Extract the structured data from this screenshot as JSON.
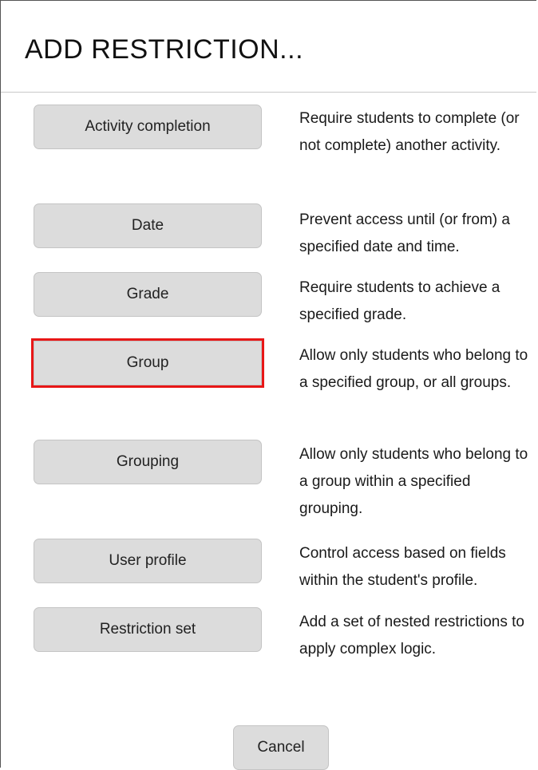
{
  "dialog": {
    "title": "ADD RESTRICTION...",
    "options": [
      {
        "label": "Activity completion",
        "description": "Require students to complete (or not complete) another activity."
      },
      {
        "label": "Date",
        "description": "Prevent access until (or from) a specified date and time."
      },
      {
        "label": "Grade",
        "description": "Require students to achieve a specified grade."
      },
      {
        "label": "Group",
        "description": "Allow only students who belong to a specified group, or all groups."
      },
      {
        "label": "Grouping",
        "description": "Allow only students who belong to a group within a specified grouping."
      },
      {
        "label": "User profile",
        "description": "Control access based on fields within the student's profile."
      },
      {
        "label": "Restriction set",
        "description": "Add a set of nested restrictions to apply complex logic."
      }
    ],
    "cancel_label": "Cancel",
    "highlight_color": "#e81717"
  }
}
